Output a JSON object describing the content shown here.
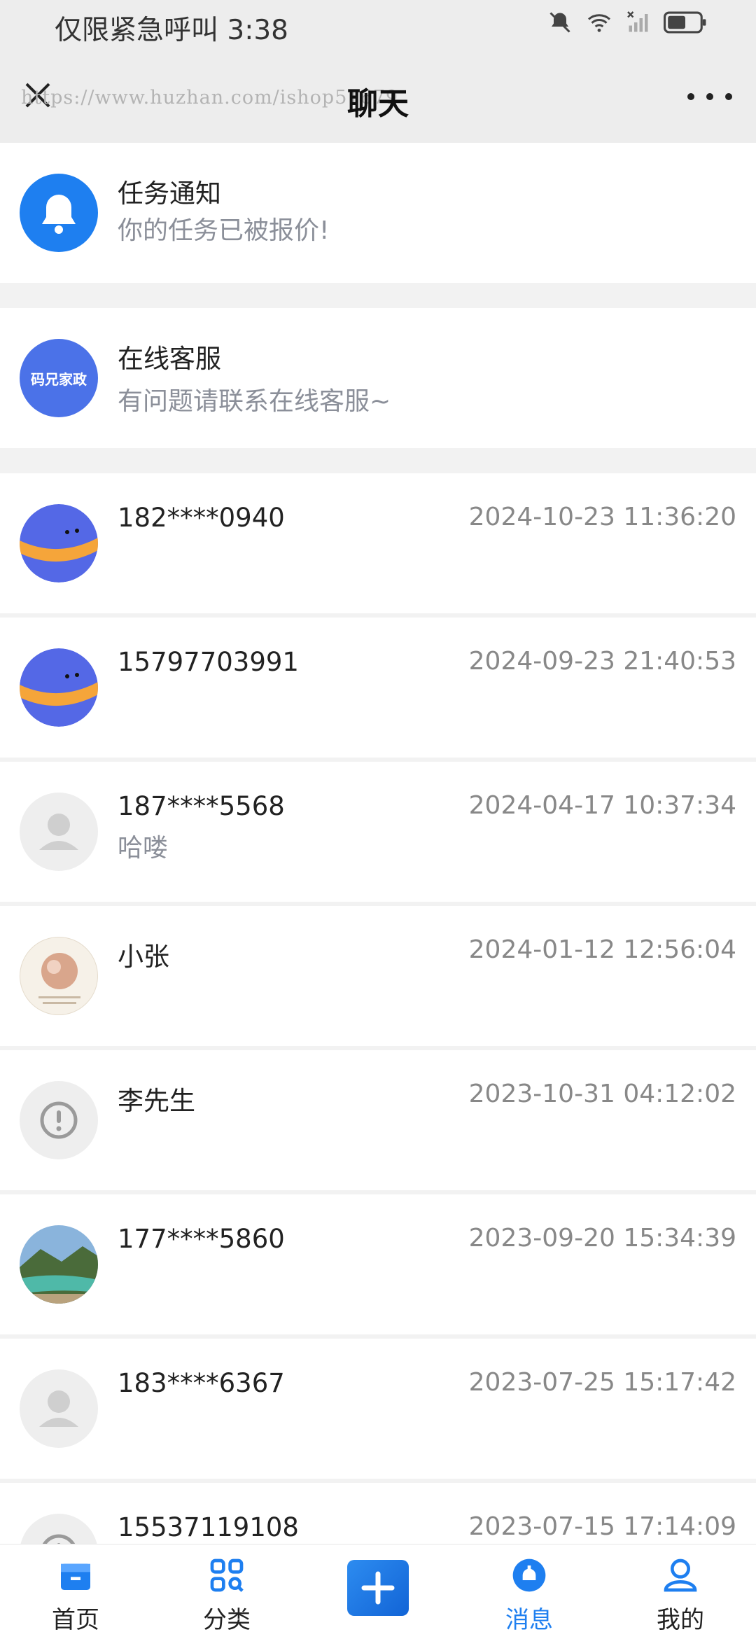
{
  "status_bar": {
    "text": "仅限紧急呼叫 3:38"
  },
  "nav": {
    "watermark": "https://www.huzhan.com/ishop51679",
    "title": "聊天"
  },
  "conversations": [
    {
      "name": "任务通知",
      "subtitle": "你的任务已被报价!",
      "time": "",
      "avatar": "bell-icon"
    },
    {
      "name": "在线客服",
      "subtitle": "有问题请联系在线客服~",
      "time": "",
      "avatar_text": "码兄家政"
    },
    {
      "name": "182****0940",
      "subtitle": "",
      "time": "2024-10-23 11:36:20",
      "avatar": "planet-avatar"
    },
    {
      "name": "15797703991",
      "subtitle": "",
      "time": "2024-09-23 21:40:53",
      "avatar": "planet-avatar"
    },
    {
      "name": "187****5568",
      "subtitle": "哈喽",
      "time": "2024-04-17 10:37:34",
      "avatar": "default-user-avatar"
    },
    {
      "name": "小张",
      "subtitle": "",
      "time": "2024-01-12 12:56:04",
      "avatar": "photo-avatar"
    },
    {
      "name": "李先生",
      "subtitle": "",
      "time": "2023-10-31 04:12:02",
      "avatar": "warning-avatar"
    },
    {
      "name": "177****5860",
      "subtitle": "",
      "time": "2023-09-20 15:34:39",
      "avatar": "landscape-avatar"
    },
    {
      "name": "183****6367",
      "subtitle": "",
      "time": "2023-07-25 15:17:42",
      "avatar": "default-user-avatar"
    },
    {
      "name": "15537119108",
      "subtitle": "",
      "time": "2023-07-15 17:14:09",
      "avatar": "warning-avatar"
    }
  ],
  "tabs": [
    {
      "label": "首页",
      "icon": "home-icon",
      "active": false
    },
    {
      "label": "分类",
      "icon": "category-icon",
      "active": false
    },
    {
      "label": "",
      "icon": "plus-icon",
      "active": false
    },
    {
      "label": "消息",
      "icon": "message-icon",
      "active": true
    },
    {
      "label": "我的",
      "icon": "profile-icon",
      "active": false
    }
  ],
  "colors": {
    "accent": "#1e7ff0",
    "muted": "#8b8f99",
    "background": "#f2f2f2"
  }
}
